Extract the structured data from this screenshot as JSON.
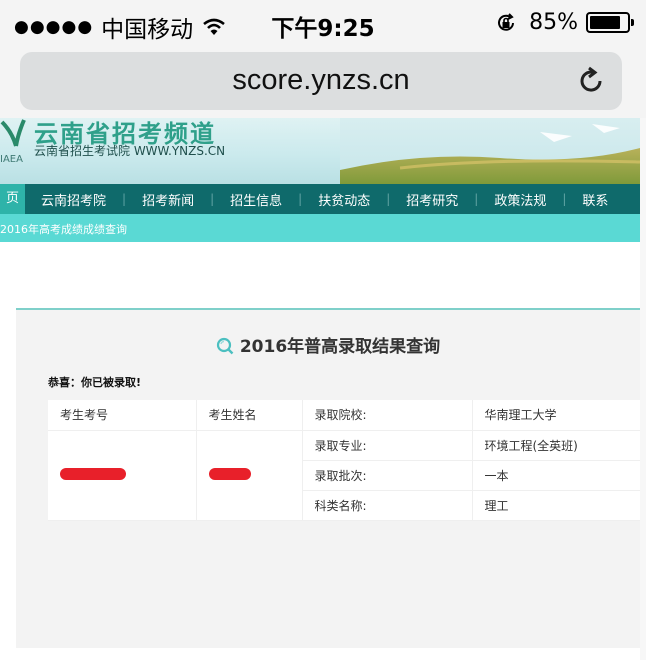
{
  "status_bar": {
    "carrier": "中国移动",
    "time": "下午9:25",
    "battery": "85%",
    "battery_level": 0.85
  },
  "browser": {
    "url": "score.ynzs.cn"
  },
  "site_header": {
    "name": "云南省招考频道",
    "subtitle": "云南省招生考试院 WWW.YNZS.CN",
    "abbr": "IAEA"
  },
  "nav": {
    "items": [
      "页",
      "云南招考院",
      "招考新闻",
      "招生信息",
      "扶贫动态",
      "招考研究",
      "政策法规",
      "联系"
    ]
  },
  "breadcrumb": "2016年高考成绩成绩查询",
  "panel": {
    "title": "2016年普高录取结果查询",
    "congrats": "恭喜：你已被录取!",
    "headers": [
      "考生考号",
      "考生姓名"
    ],
    "rows": [
      {
        "label": "录取院校:",
        "value": "华南理工大学"
      },
      {
        "label": "录取专业:",
        "value": "环境工程(全英班)"
      },
      {
        "label": "录取批次:",
        "value": "一本"
      },
      {
        "label": "科类名称:",
        "value": "理工"
      }
    ]
  },
  "colors": {
    "nav_bg": "#0f6a6b",
    "nav_active": "#2eb3a9",
    "sub_bar": "#5ad9d4",
    "redaction": "#e8202a"
  }
}
